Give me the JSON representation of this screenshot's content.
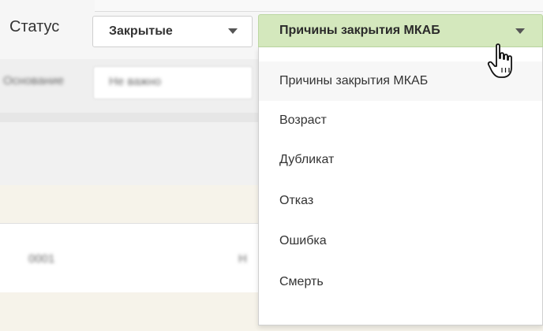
{
  "filter": {
    "status_label": "Статус",
    "status_value": "Закрытые",
    "reason_value": "Причины закрытия МКАБ"
  },
  "background": {
    "blurred_label": "Основание",
    "blurred_value": "Не важно",
    "blurred_cell_1": "0001",
    "blurred_cell_2": "Н"
  },
  "dropdown": {
    "options": [
      "Причины закрытия МКАБ",
      "Возраст",
      "Дубликат",
      "Отказ",
      "Ошибка",
      "Смерть"
    ]
  },
  "icons": {
    "caret": "chevron-down-icon",
    "cursor": "hand-pointer-icon"
  },
  "colors": {
    "trigger_bg": "#d4e8bd",
    "menu_bg": "#ffffff"
  }
}
